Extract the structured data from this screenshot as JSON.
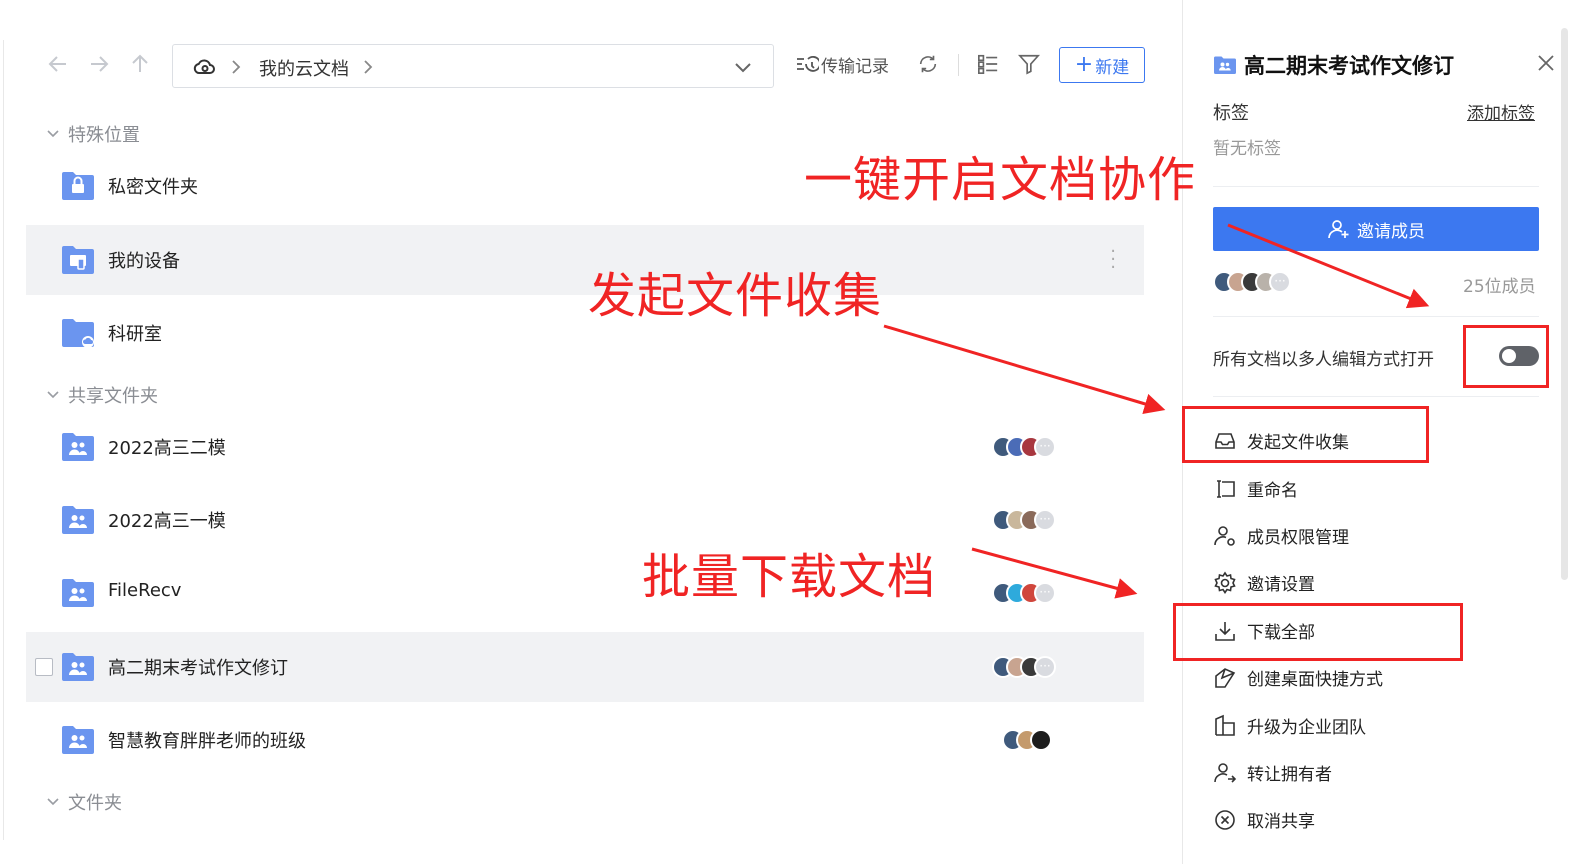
{
  "toolbar": {
    "path_root": "我的云文档",
    "transfer_label": "传输记录",
    "new_label": "新建"
  },
  "sections": {
    "special": "特殊位置",
    "shared": "共享文件夹",
    "folders": "文件夹"
  },
  "special_items": [
    {
      "name": "私密文件夹",
      "icon": "lock-folder-icon"
    },
    {
      "name": "我的设备",
      "icon": "device-folder-icon"
    },
    {
      "name": "科研室",
      "icon": "cloud-folder-icon"
    }
  ],
  "shared_items": [
    {
      "name": "2022高三二模"
    },
    {
      "name": "2022高三一模"
    },
    {
      "name": "FileRecv"
    },
    {
      "name": "高二期末考试作文修订"
    },
    {
      "name": "智慧教育胖胖老师的班级"
    }
  ],
  "panel": {
    "title": "高二期末考试作文修订",
    "tag_label": "标签",
    "add_tag": "添加标签",
    "no_tag": "暂无标签",
    "invite_button": "邀请成员",
    "member_count": "25位成员",
    "multi_edit_label": "所有文档以多人编辑方式打开",
    "multi_edit_on": false,
    "menu": [
      {
        "label": "发起文件收集",
        "icon": "inbox-icon"
      },
      {
        "label": "重命名",
        "icon": "rename-icon"
      },
      {
        "label": "成员权限管理",
        "icon": "member-permission-icon"
      },
      {
        "label": "邀请设置",
        "icon": "gear-icon"
      },
      {
        "label": "下载全部",
        "icon": "download-icon"
      },
      {
        "label": "创建桌面快捷方式",
        "icon": "shortcut-icon"
      },
      {
        "label": "升级为企业团队",
        "icon": "building-icon"
      },
      {
        "label": "转让拥有者",
        "icon": "transfer-owner-icon"
      },
      {
        "label": "取消共享",
        "icon": "cancel-share-icon"
      }
    ]
  },
  "annotations": {
    "collab": "一键开启文档协作",
    "collect": "发起文件收集",
    "download": "批量下载文档"
  },
  "colors": {
    "accent": "#3c78f0",
    "folder": "#6b95ef",
    "annotation": "#f02424"
  }
}
